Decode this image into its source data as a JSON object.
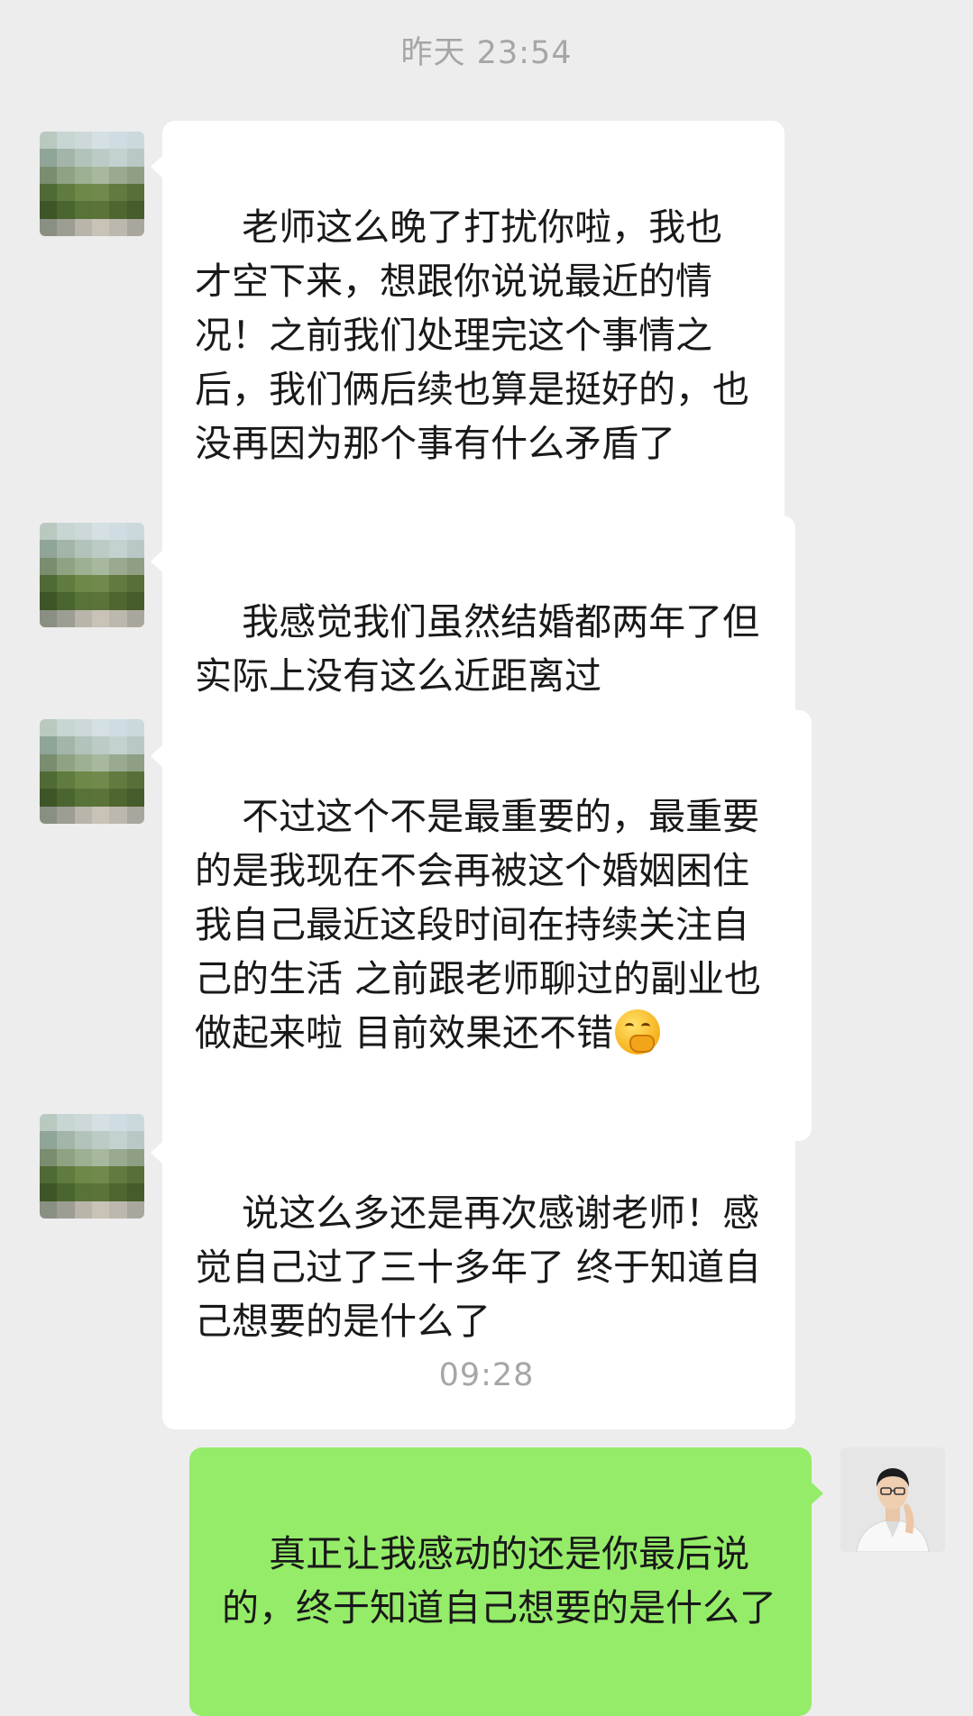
{
  "timestamps": [
    "昨天 23:54",
    "09:28"
  ],
  "messages": [
    {
      "sender": "contact",
      "text": "老师这么晚了打扰你啦，我也才空下来，想跟你说说最近的情况！之前我们处理完这个事情之后，我们俩后续也算是挺好的，也没再因为那个事有什么矛盾了"
    },
    {
      "sender": "contact",
      "text": "我感觉我们虽然结婚都两年了但实际上没有这么近距离过"
    },
    {
      "sender": "contact",
      "text": "不过这个不是最重要的，最重要的是我现在不会再被这个婚姻困住 我自己最近这段时间在持续关注自己的生活 之前跟老师聊过的副业也做起来啦 目前效果还不错",
      "emoji": "thinking-face-icon"
    },
    {
      "sender": "contact",
      "text": "说这么多还是再次感谢老师！感觉自己过了三十多年了 终于知道自己想要的是什么了"
    },
    {
      "sender": "self",
      "text": "真正让我感动的还是你最后说的，终于知道自己想要的是什么了"
    }
  ],
  "colors": {
    "background": "#ededed",
    "incoming_bubble": "#ffffff",
    "outgoing_bubble": "#95ec69",
    "timestamp": "#a6a6a6"
  }
}
